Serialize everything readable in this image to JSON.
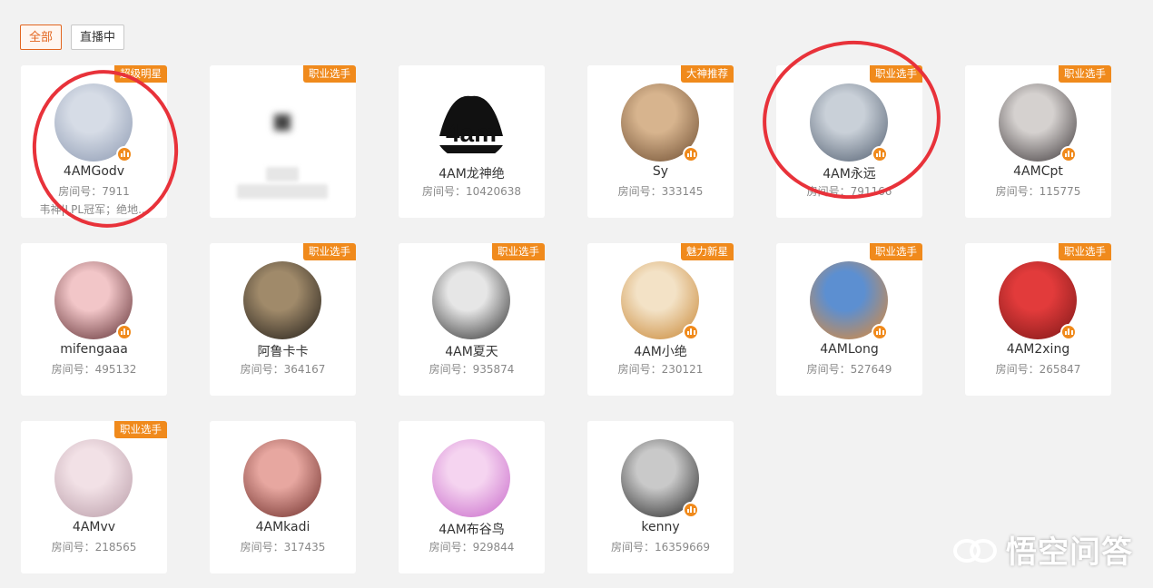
{
  "filters": [
    {
      "label": "全部",
      "active": true
    },
    {
      "label": "直播中",
      "active": false
    }
  ],
  "room_prefix": "房间号：",
  "cards": [
    {
      "name": "4AMGodv",
      "room": "7911",
      "badge": "超级明星",
      "desc": "韦神|LPL冠军；绝地...",
      "avatar_colors": [
        "#d6dce6",
        "#8a97b0"
      ],
      "live": true
    },
    {
      "name": "",
      "room": "",
      "badge": "职业选手",
      "desc": "",
      "avatar_colors": [
        "#ffffff",
        "#ffffff"
      ],
      "live": false,
      "blurred": true
    },
    {
      "name": "4AM龙神绝",
      "room": "10420638",
      "badge": "",
      "desc": "",
      "avatar_colors": [
        "#ffffff",
        "#111111"
      ],
      "live": false,
      "logo": "4am"
    },
    {
      "name": "Sy",
      "room": "333145",
      "badge": "大神推荐",
      "desc": "",
      "avatar_colors": [
        "#d7b48e",
        "#6b4a2e"
      ],
      "live": true
    },
    {
      "name": "4AM永远",
      "room": "791166",
      "badge": "职业选手",
      "desc": "",
      "avatar_colors": [
        "#c9d0d8",
        "#4d5a6c"
      ],
      "live": true
    },
    {
      "name": "4AMCpt",
      "room": "115775",
      "badge": "职业选手",
      "desc": "",
      "avatar_colors": [
        "#d5d1cf",
        "#3a3436"
      ],
      "live": true
    },
    {
      "name": "mifengaaa",
      "room": "495132",
      "badge": "",
      "desc": "",
      "avatar_colors": [
        "#f2c6c8",
        "#5a2a2e"
      ],
      "live": true
    },
    {
      "name": "阿鲁卡卡",
      "room": "364167",
      "badge": "职业选手",
      "desc": "",
      "avatar_colors": [
        "#a08a6a",
        "#1e1a16"
      ],
      "live": false
    },
    {
      "name": "4AM夏天",
      "room": "935874",
      "badge": "职业选手",
      "desc": "",
      "avatar_colors": [
        "#e6e6e6",
        "#2a2a2a"
      ],
      "live": false
    },
    {
      "name": "4AM小绝",
      "room": "230121",
      "badge": "魅力新星",
      "desc": "",
      "avatar_colors": [
        "#f3e2c6",
        "#c7832f"
      ],
      "live": true
    },
    {
      "name": "4AMLong",
      "room": "527649",
      "badge": "职业选手",
      "desc": "",
      "avatar_colors": [
        "#5c8fd1",
        "#e58a2f"
      ],
      "live": true
    },
    {
      "name": "4AM2xing",
      "room": "265847",
      "badge": "职业选手",
      "desc": "",
      "avatar_colors": [
        "#e23b3b",
        "#7a1616"
      ],
      "live": true
    },
    {
      "name": "4AMvv",
      "room": "218565",
      "badge": "职业选手",
      "desc": "",
      "avatar_colors": [
        "#f2e1e6",
        "#b79aa6"
      ],
      "live": false
    },
    {
      "name": "4AMkadi",
      "room": "317435",
      "badge": "",
      "desc": "",
      "avatar_colors": [
        "#e7a7a0",
        "#6a2a26"
      ],
      "live": false
    },
    {
      "name": "4AM布谷鸟",
      "room": "929844",
      "badge": "",
      "desc": "",
      "avatar_colors": [
        "#f5d4f0",
        "#c766c9"
      ],
      "live": false
    },
    {
      "name": "kenny",
      "room": "16359669",
      "badge": "",
      "desc": "",
      "avatar_colors": [
        "#c9c9c9",
        "#232323"
      ],
      "live": true
    }
  ],
  "watermark": {
    "text": "悟空问答",
    "icon": "wukong-logo-icon"
  },
  "colors": {
    "accent": "#f08a1c",
    "mark": "#e8323a",
    "active_filter": "#e2651f"
  }
}
